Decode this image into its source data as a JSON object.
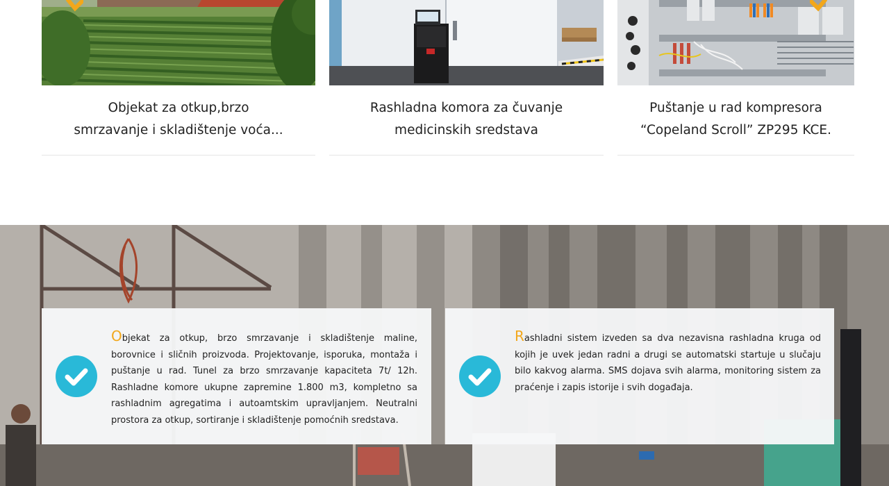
{
  "colors": {
    "accent_orange": "#f2a71b",
    "check_blue": "#29b9d8",
    "box_bg": "#f6f7f8",
    "divider": "#e6e6e6"
  },
  "carousel": {
    "prev_icon": "chevron-left-icon",
    "next_icon": "chevron-right-icon",
    "cards": [
      {
        "line1": "Objekat za otkup,brzo",
        "line2": "smrzavanje i skladištenje voća..."
      },
      {
        "line1": "Rashladna komora za čuvanje",
        "line2": "medicinskih sredstava"
      },
      {
        "line1": "Puštanje u rad kompresora",
        "line2": "“Copeland Scroll” ZP295 KCE."
      }
    ]
  },
  "features": {
    "icon": "check-circle-icon",
    "items": [
      {
        "dropcap": "O",
        "text": "bjekat za otkup, brzo smrzavanje i skladištenje maline, borovnice i sličnih proizvoda. Projektovanje, isporuka, montaža i puštanje u rad. Tunel za brzo smrzavanje kapaciteta 7t/ 12h. Rashladne komore ukupne zapremine 1.800 m3, kompletno sa rashladnim agregatima i autoamtskim upravljanjem. Neutralni prostora za otkup, sortiranje i skladištenje pomoćnih sredstava."
      },
      {
        "dropcap": "R",
        "text": "ashladni sistem izveden sa dva nezavisna rashladna kruga od kojih je uvek jedan radni a drugi se automatski startuje u slučaju bilo kakvog alarma. SMS dojava svih alarma, monitoring sistem za praćenje i zapis istorije i svih događaja."
      }
    ]
  }
}
